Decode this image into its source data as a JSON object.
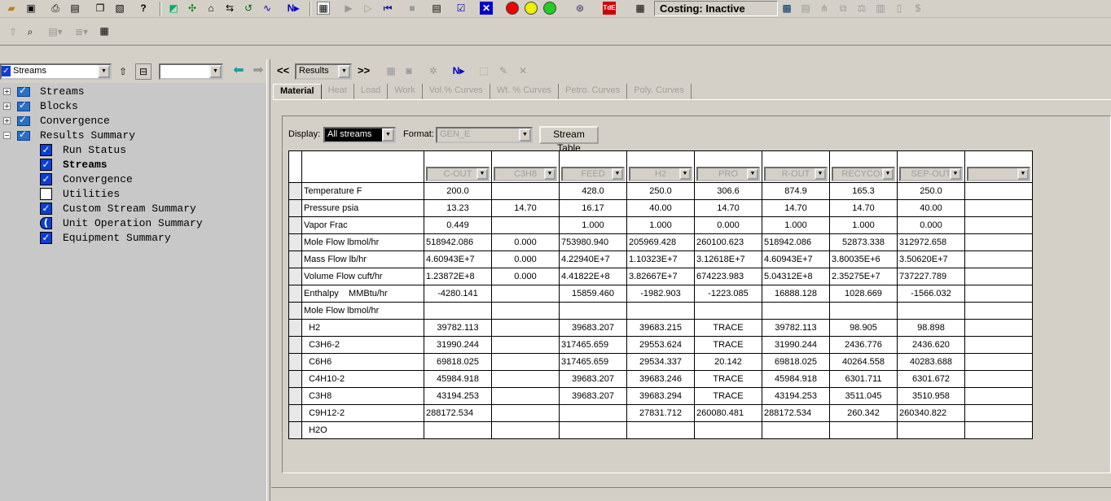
{
  "toolbar": {
    "costing_label": "Costing: Inactive",
    "icons": [
      "open-icon",
      "save-icon",
      "print-icon",
      "print-preview-icon",
      "copy-icon",
      "paste-icon",
      "help-icon",
      "flowsheet-icon",
      "nodes-icon",
      "house-icon",
      "reconnect-icon",
      "ring-icon",
      "tilde-icon",
      "next-icon",
      "data-browser-icon",
      "step-icon",
      "step-forward-icon",
      "rewind-icon",
      "stop-icon",
      "control-panel-icon",
      "check-results-icon",
      "reset-icon",
      "red-light-icon",
      "yellow-light-icon",
      "green-light-icon",
      "model-library-icon",
      "tdf-icon",
      "grid-icon"
    ]
  },
  "nav": {
    "section_select": "Streams",
    "view_select": "",
    "results_select": "Results",
    "prev_label": "<<",
    "next_label": ">>"
  },
  "tree": {
    "items": [
      {
        "label": "Streams",
        "level": 0
      },
      {
        "label": "Blocks",
        "level": 0
      },
      {
        "label": "Convergence",
        "level": 0
      },
      {
        "label": "Results Summary",
        "level": 0
      },
      {
        "label": "Run Status",
        "level": 1,
        "state": "on"
      },
      {
        "label": "Streams",
        "level": 1,
        "state": "on",
        "bold": true
      },
      {
        "label": "Convergence",
        "level": 1,
        "state": "on"
      },
      {
        "label": "Utilities",
        "level": 1,
        "state": "off"
      },
      {
        "label": "Custom Stream Summary",
        "level": 1,
        "state": "on"
      },
      {
        "label": "Unit Operation Summary",
        "level": 1,
        "state": "half"
      },
      {
        "label": "Equipment Summary",
        "level": 1,
        "state": "on"
      }
    ]
  },
  "tabs": [
    "Material",
    "Heat",
    "Load",
    "Work",
    "Vol.% Curves",
    "Wt. % Curves",
    "Petro. Curves",
    "Poly. Curves"
  ],
  "form": {
    "display_label": "Display:",
    "display_value": "All streams",
    "format_label": "Format:",
    "format_value": "GEN_E",
    "stream_table_button": "Stream Table"
  },
  "table": {
    "columns": [
      "C-OUT",
      "C3H8",
      "FEED",
      "H2",
      "PRO",
      "R-OUT",
      "RECYCOL",
      "SEP-OUT",
      ""
    ],
    "rows": [
      {
        "label": "Temperature F",
        "values": [
          "200.0",
          "",
          "428.0",
          "250.0",
          "306.6",
          "874.9",
          "165.3",
          "250.0",
          ""
        ]
      },
      {
        "label": "Pressure psia",
        "values": [
          "13.23",
          "14.70",
          "16.17",
          "40.00",
          "14.70",
          "14.70",
          "14.70",
          "40.00",
          ""
        ]
      },
      {
        "label": "Vapor Frac",
        "values": [
          "0.449",
          "",
          "1.000",
          "1.000",
          "0.000",
          "1.000",
          "1.000",
          "0.000",
          ""
        ]
      },
      {
        "label": "Mole Flow lbmol/hr",
        "values": [
          "518942.086",
          "0.000",
          "753980.940",
          "205969.428",
          "260100.623",
          "518942.086",
          "52873.338",
          "312972.658",
          ""
        ]
      },
      {
        "label": "Mass Flow lb/hr",
        "values": [
          "4.60943E+7",
          "0.000",
          "4.22940E+7",
          "1.10323E+7",
          "3.12618E+7",
          "4.60943E+7",
          "3.80035E+6",
          "3.50620E+7",
          ""
        ]
      },
      {
        "label": "Volume Flow cuft/hr",
        "values": [
          "1.23872E+8",
          "0.000",
          "4.41822E+8",
          "3.82667E+7",
          "674223.983",
          "5.04312E+8",
          "2.35275E+7",
          "737227.789",
          ""
        ]
      },
      {
        "label": "Enthalpy    MMBtu/hr",
        "values": [
          "-4280.141",
          "",
          "15859.460",
          "-1982.903",
          "-1223.085",
          "16888.128",
          "1028.669",
          "-1566.032",
          ""
        ]
      },
      {
        "label": "Mole Flow lbmol/hr",
        "values": [
          "",
          "",
          "",
          "",
          "",
          "",
          "",
          "",
          ""
        ]
      },
      {
        "label": "  H2",
        "values": [
          "39782.113",
          "",
          "39683.207",
          "39683.215",
          "TRACE",
          "39782.113",
          "98.905",
          "98.898",
          ""
        ]
      },
      {
        "label": "  C3H6-2",
        "values": [
          "31990.244",
          "",
          "317465.659",
          "29553.624",
          "TRACE",
          "31990.244",
          "2436.776",
          "2436.620",
          ""
        ]
      },
      {
        "label": "  C6H6",
        "values": [
          "69818.025",
          "",
          "317465.659",
          "29534.337",
          "20.142",
          "69818.025",
          "40264.558",
          "40283.688",
          ""
        ]
      },
      {
        "label": "  C4H10-2",
        "values": [
          "45984.918",
          "",
          "39683.207",
          "39683.246",
          "TRACE",
          "45984.918",
          "6301.711",
          "6301.672",
          ""
        ]
      },
      {
        "label": "  C3H8",
        "values": [
          "43194.253",
          "",
          "39683.207",
          "39683.294",
          "TRACE",
          "43194.253",
          "3511.045",
          "3510.958",
          ""
        ]
      },
      {
        "label": "  C9H12-2",
        "values": [
          "288172.534",
          "",
          "",
          "27831.712",
          "260080.481",
          "288172.534",
          "260.342",
          "260340.822",
          ""
        ]
      },
      {
        "label": "  H2O",
        "values": [
          "",
          "",
          "",
          "",
          "",
          "",
          "",
          "",
          ""
        ]
      }
    ]
  }
}
